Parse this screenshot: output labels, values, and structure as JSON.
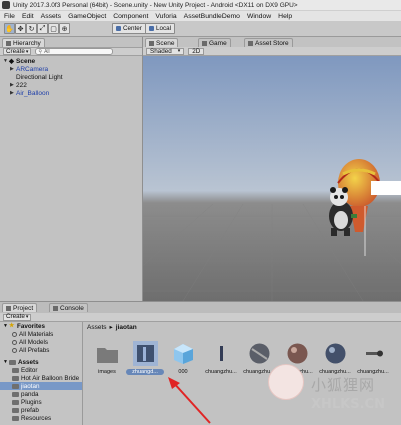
{
  "window": {
    "title": "Unity 2017.3.0f3 Personal (64bit) - Scene.unity - New Unity Project - Android <DX11 on DX9 GPU>"
  },
  "menu": [
    "File",
    "Edit",
    "Assets",
    "GameObject",
    "Component",
    "Vuforia",
    "AssetBundleDemo",
    "Window",
    "Help"
  ],
  "toolbar": {
    "pivot": "Center",
    "space": "Local",
    "tools": [
      "hand-icon",
      "move-icon",
      "rotate-icon",
      "scale-icon",
      "rect-icon",
      "transform-icon"
    ]
  },
  "hierarchy": {
    "tab": "Hierarchy",
    "create": "Create",
    "search_placeholder": "All",
    "scene": "Scene",
    "items": [
      "ARCamera",
      "Directional Light",
      "222",
      "Air_Balloon"
    ]
  },
  "scene_panel": {
    "tabs": [
      "Scene",
      "Game",
      "Asset Store"
    ],
    "shading": "Shaded",
    "mode": "2D"
  },
  "project": {
    "tabs": [
      "Project",
      "Console"
    ],
    "create": "Create",
    "favorites": {
      "label": "Favorites",
      "items": [
        "All Materials",
        "All Models",
        "All Prefabs"
      ]
    },
    "assets": {
      "label": "Assets",
      "items": [
        "Editor",
        "Hot Air Balloon Bride",
        "jiaotan",
        "panda",
        "Plugins",
        "prefab",
        "Resources"
      ]
    },
    "breadcrumb": [
      "Assets",
      "jiaotan"
    ],
    "grid": [
      "images",
      "zhuangd...",
      "000",
      "chuangzhu...",
      "chuangzhu...",
      "chuangzhu...",
      "chuangzhu...",
      "chuangzhu..."
    ]
  },
  "watermark": {
    "cn": "小狐狸网",
    "en": "XHLKS.CN"
  },
  "colors": {
    "selection": "#6787b8",
    "sky_top": "#7f98bf",
    "ground": "#6e6e6e"
  }
}
